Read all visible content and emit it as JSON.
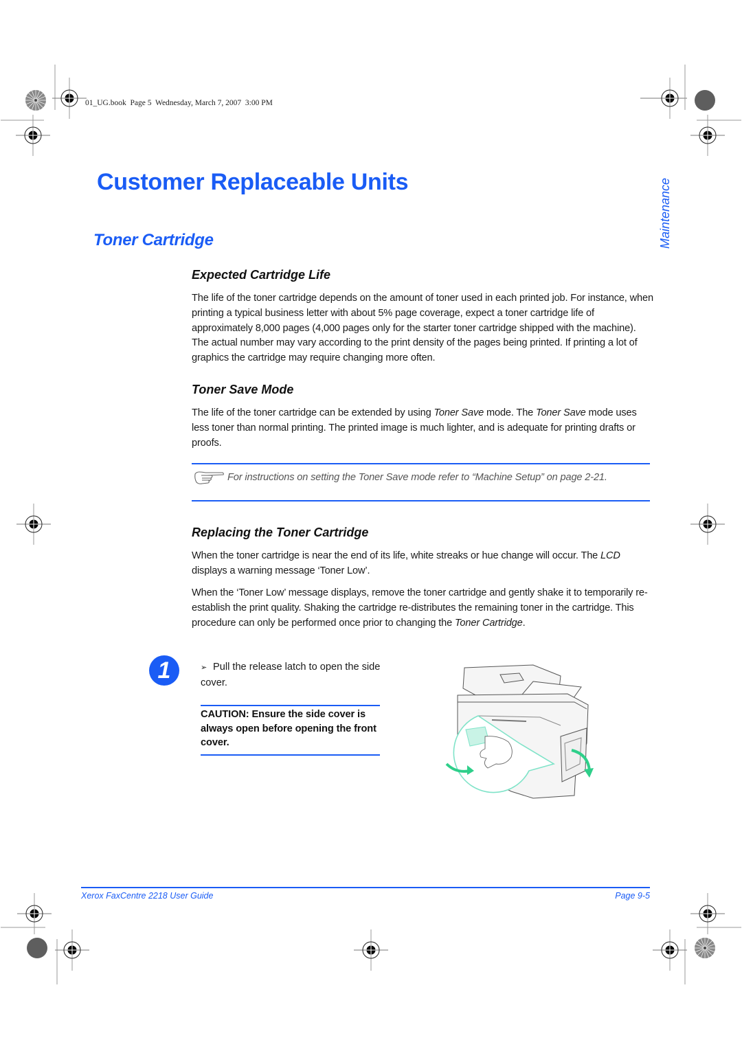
{
  "print_header": "01_UG.book  Page 5  Wednesday, March 7, 2007  3:00 PM",
  "side_tab": "Maintenance",
  "title": "Customer Replaceable Units",
  "section_title": "Toner Cartridge",
  "sections": {
    "expected_life": {
      "heading": "Expected Cartridge Life",
      "body": "The life of the toner cartridge depends on the amount of toner used in each printed job. For instance, when printing a typical business letter with about 5% page coverage, expect a toner cartridge life of approximately 8,000 pages (4,000 pages only for the starter toner cartridge shipped with the machine). The actual number may vary according to the print density of the pages being printed. If printing a lot of graphics the cartridge may require changing more often."
    },
    "toner_save": {
      "heading": "Toner Save Mode",
      "body_parts": {
        "p1": "The life of the toner cartridge can be extended by using ",
        "em1": "Toner Save",
        "p2": " mode. The ",
        "em2": "Toner Save",
        "p3": " mode uses less toner than normal printing. The printed image is much lighter, and is adequate for printing drafts or proofs."
      },
      "note": "For instructions on setting the Toner Save mode refer to “Machine Setup” on page 2-21.",
      "note_icon": "pointing-hand-icon"
    },
    "replacing": {
      "heading": "Replacing the Toner Cartridge",
      "para1": {
        "p1": "When the toner cartridge is near the end of its life, white streaks or hue change will occur. The ",
        "em1": "LCD",
        "p2": " displays a warning message ‘Toner Low’."
      },
      "para2": {
        "p1": "When the ‘Toner Low’ message displays, remove the toner cartridge and gently shake it to temporarily re-establish the print quality. Shaking the cartridge re-distributes the remaining toner in the cartridge. This procedure can only be performed once prior to changing the ",
        "em1": "Toner Cartridge",
        "p2": "."
      }
    }
  },
  "step": {
    "number": "1",
    "bullet": "➢",
    "instruction": "Pull the release latch to open the side cover.",
    "caution": "CAUTION: Ensure the side cover is always open before opening the front cover.",
    "illustration": "copier-side-cover-illustration"
  },
  "footer": {
    "guide_title": "Xerox FaxCentre 2218 User Guide",
    "page": "Page 9-5"
  },
  "colors": {
    "accent": "#1a5cf5",
    "callout_green": "#7fe3c8",
    "arrow_green": "#2ecf8a"
  }
}
